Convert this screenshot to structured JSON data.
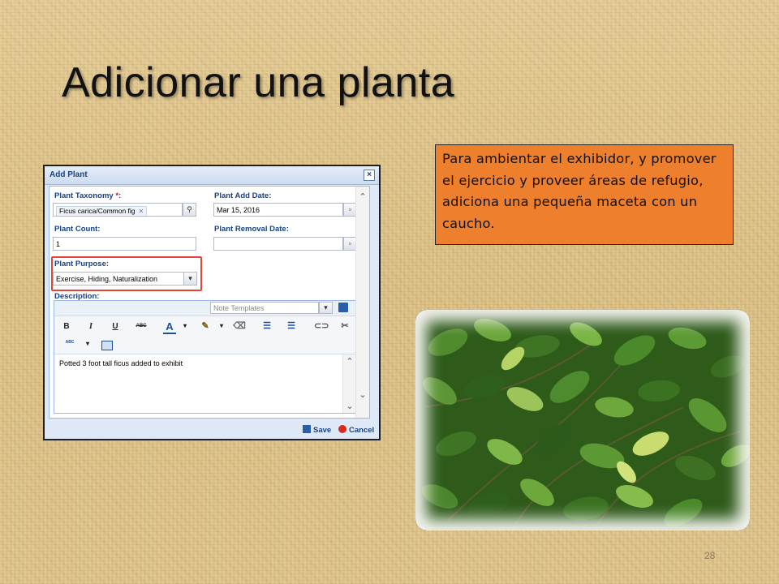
{
  "slide": {
    "title": "Adicionar una planta",
    "callout": "Para ambientar el exhibidor, y promover el ejercicio y proveer áreas de refugio, adiciona una pequeña maceta con un caucho.",
    "page_number": "28"
  },
  "colors": {
    "callout_bg": "#ee7f2d",
    "highlight": "#e0453a",
    "dialog_title": "#15428b"
  },
  "dialog": {
    "title": "Add Plant",
    "close_icon": "close-icon",
    "taxonomy_label": "Plant Taxonomy ",
    "taxonomy_required": "*",
    "taxonomy_label_suffix": ":",
    "taxonomy_tag": "Ficus carica/Common fig",
    "add_date_label": "Plant Add Date:",
    "add_date_value": "Mar 15, 2016",
    "count_label": "Plant Count:",
    "count_value": "1",
    "removal_date_label": "Plant Removal Date:",
    "removal_date_value": "",
    "purpose_label": "Plant Purpose:",
    "purpose_value": "Exercise, Hiding, Naturalization",
    "description_label": "Description:",
    "note_templates_placeholder": "Note Templates",
    "toolbar": {
      "bold": "B",
      "italic": "I",
      "underline": "U",
      "strike": "ABC",
      "font_color": "A",
      "spell": "ABC"
    },
    "description_text": "Potted 3 foot tall ficus added to exhibit",
    "save_label": "Save",
    "cancel_label": "Cancel"
  }
}
